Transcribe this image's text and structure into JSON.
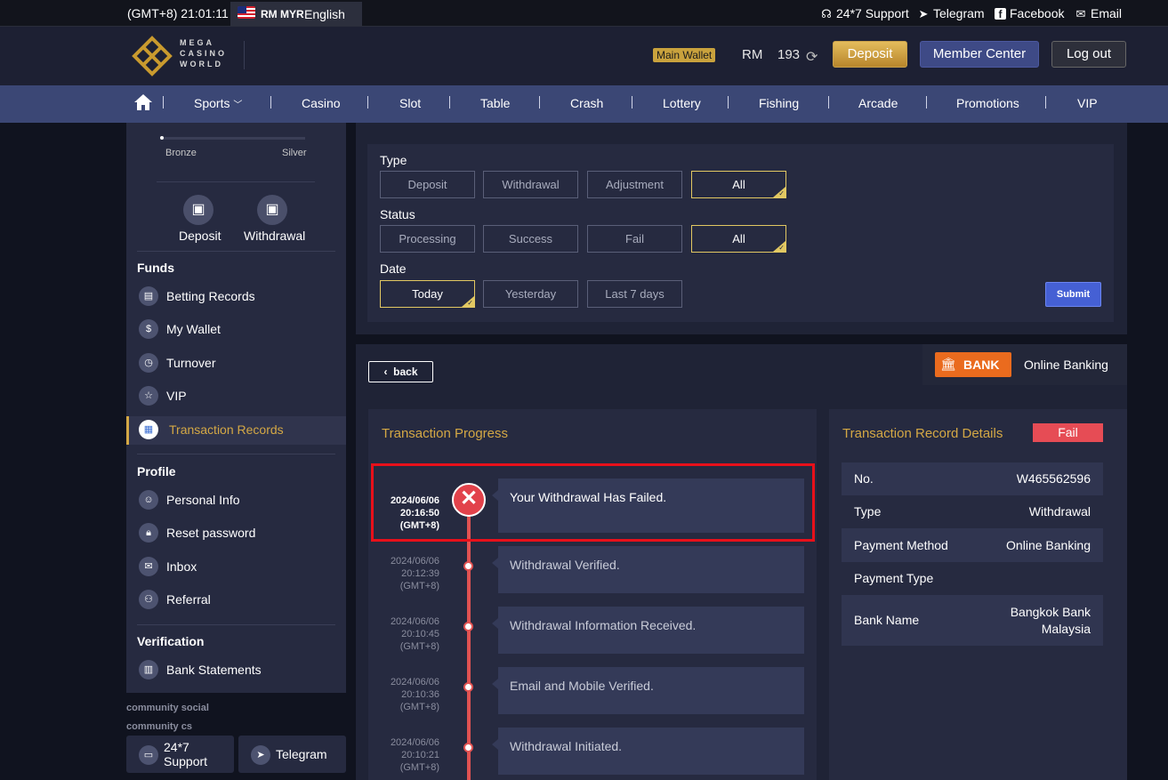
{
  "topbar": {
    "time": "(GMT+8) 21:01:11",
    "currency": "RM MYR",
    "language": "English",
    "links": [
      {
        "label": "24*7 Support",
        "icon": "headset-icon"
      },
      {
        "label": "Telegram",
        "icon": "telegram-icon"
      },
      {
        "label": "Facebook",
        "icon": "facebook-icon"
      },
      {
        "label": "Email",
        "icon": "email-icon"
      }
    ]
  },
  "header": {
    "logo_lines": [
      "MEGA",
      "CASINO",
      "WORLD"
    ],
    "wallet_label": "Main Wallet",
    "currency": "RM",
    "balance": "193",
    "deposit": "Deposit",
    "member_center": "Member Center",
    "logout": "Log out"
  },
  "nav": [
    "Sports",
    "Casino",
    "Slot",
    "Table",
    "Crash",
    "Lottery",
    "Fishing",
    "Arcade",
    "Promotions",
    "VIP"
  ],
  "sidebar": {
    "level_from": "Bronze",
    "level_to": "Silver",
    "level_progress": 0.01,
    "quick": [
      "Deposit",
      "Withdrawal"
    ],
    "funds_title": "Funds",
    "funds": [
      "Betting Records",
      "My Wallet",
      "Turnover",
      "VIP",
      "Transaction Records"
    ],
    "profile_title": "Profile",
    "profile": [
      "Personal Info",
      "Reset password",
      "Inbox",
      "Referral"
    ],
    "verification_title": "Verification",
    "verification": [
      "Bank Statements"
    ],
    "community_social": "community social",
    "community_cs": "community cs",
    "cs_buttons": [
      "24*7 Support",
      "Telegram"
    ]
  },
  "filters": {
    "type_label": "Type",
    "type_options": [
      "Deposit",
      "Withdrawal",
      "Adjustment",
      "All"
    ],
    "status_label": "Status",
    "status_options": [
      "Processing",
      "Success",
      "Fail",
      "All"
    ],
    "date_label": "Date",
    "date_options": [
      "Today",
      "Yesterday",
      "Last 7 days"
    ],
    "submit": "Submit"
  },
  "detail": {
    "back": "back",
    "bank_logo": "BANK",
    "payment_method": "Online Banking",
    "progress_title": "Transaction Progress",
    "timeline": [
      {
        "date": "2024/06/06",
        "time": "20:16:50",
        "tz": "(GMT+8)",
        "message": "Your Withdrawal Has Failed."
      },
      {
        "date": "2024/06/06",
        "time": "20:12:39",
        "tz": "(GMT+8)",
        "message": "Withdrawal Verified."
      },
      {
        "date": "2024/06/06",
        "time": "20:10:45",
        "tz": "(GMT+8)",
        "message": "Withdrawal Information Received."
      },
      {
        "date": "2024/06/06",
        "time": "20:10:36",
        "tz": "(GMT+8)",
        "message": "Email and Mobile Verified."
      },
      {
        "date": "2024/06/06",
        "time": "20:10:21",
        "tz": "(GMT+8)",
        "message": "Withdrawal Initiated."
      }
    ],
    "record_title": "Transaction Record Details",
    "status": "Fail",
    "rows": [
      {
        "key": "No.",
        "value": "W465562596"
      },
      {
        "key": "Type",
        "value": "Withdrawal"
      },
      {
        "key": "Payment Method",
        "value": "Online Banking"
      },
      {
        "key": "Payment Type",
        "value": ""
      },
      {
        "key": "Bank Name",
        "value": "Bangkok Bank",
        "value2": "Malaysia"
      }
    ]
  },
  "colors": {
    "accent": "#d4a845",
    "fail": "#e64c55",
    "nav": "#3b4775",
    "panel": "#262a40"
  }
}
